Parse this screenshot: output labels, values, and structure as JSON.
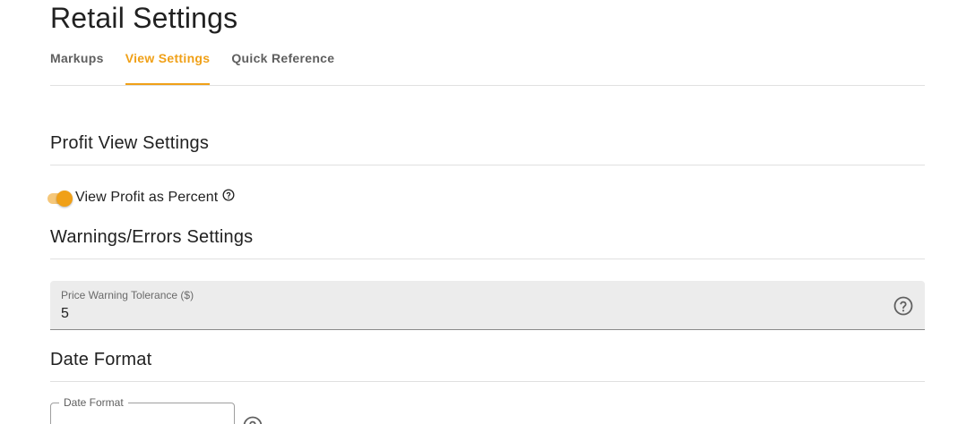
{
  "page": {
    "title": "Retail Settings"
  },
  "tabs": [
    {
      "label": "Markups",
      "active": false
    },
    {
      "label": "View Settings",
      "active": true
    },
    {
      "label": "Quick Reference",
      "active": false
    }
  ],
  "profit_view": {
    "heading": "Profit View Settings",
    "toggle_label": "View Profit as Percent",
    "toggle_on": true,
    "help_icon": "help-circle-icon"
  },
  "warnings": {
    "heading": "Warnings/Errors Settings",
    "price_tolerance_label": "Price Warning Tolerance ($)",
    "price_tolerance_value": "5",
    "help_icon": "help-circle-icon"
  },
  "date_format": {
    "heading": "Date Format",
    "field_label": "Date Format",
    "field_value": "",
    "help_icon": "help-circle-icon"
  },
  "colors": {
    "accent": "#f0a017",
    "accent_light": "#f5c77a",
    "field_background": "#ececec"
  }
}
